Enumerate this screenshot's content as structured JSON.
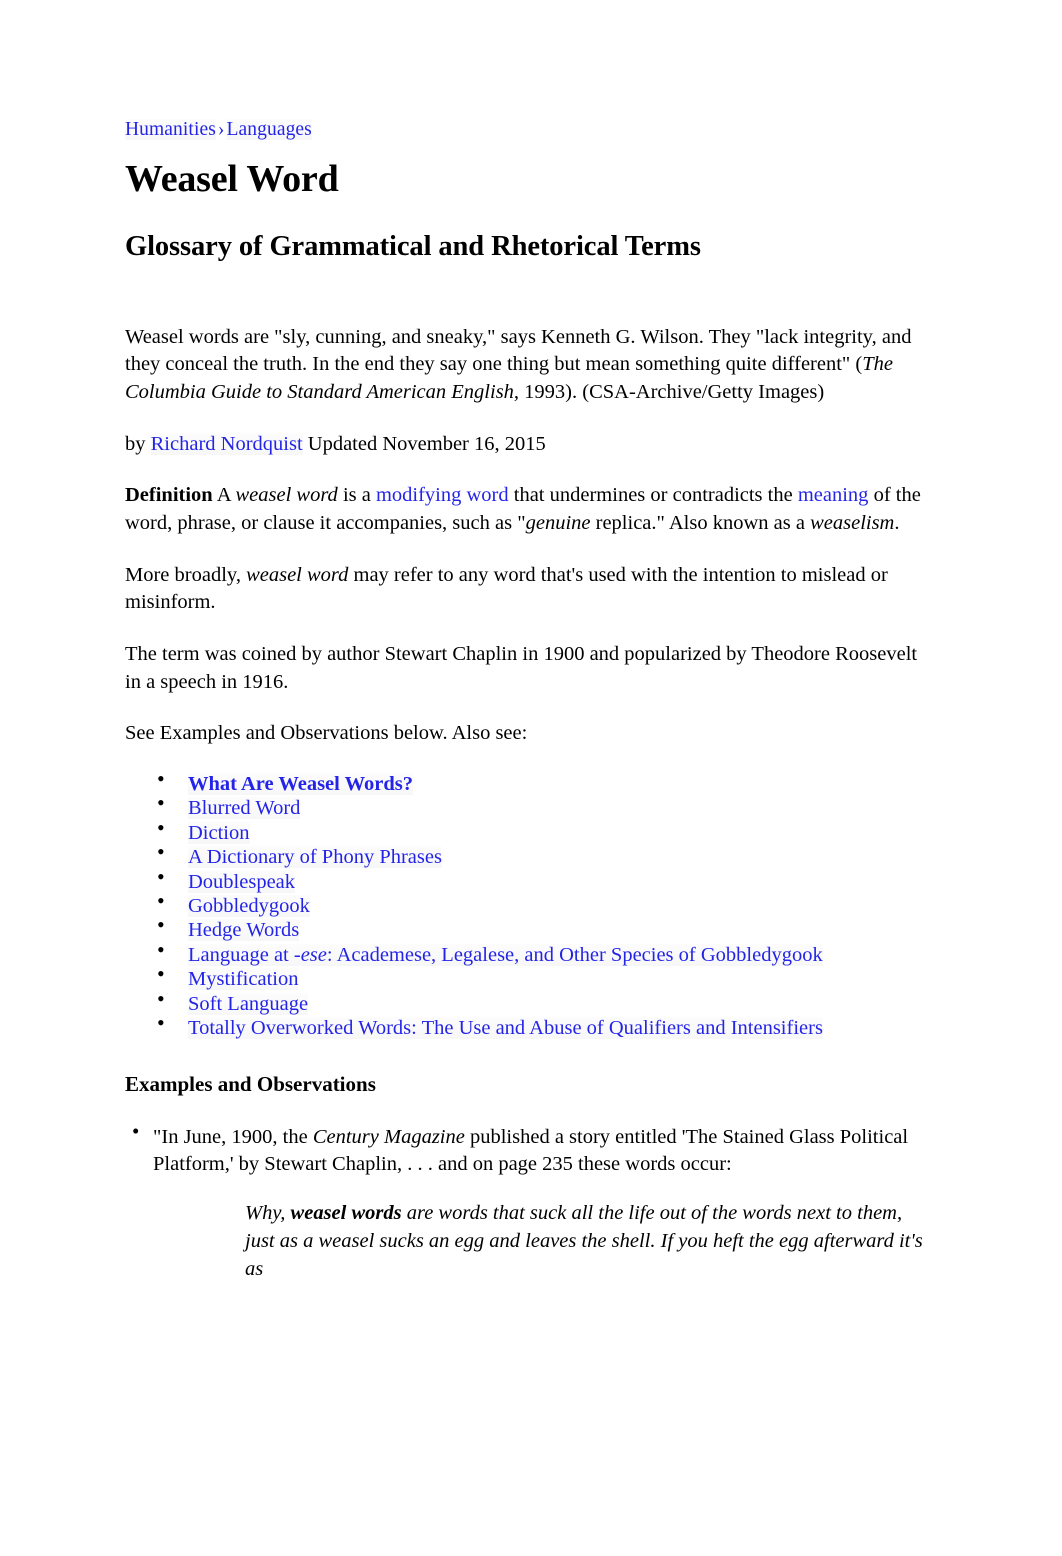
{
  "breadcrumb": {
    "items": [
      {
        "label": "Humanities"
      },
      {
        "label": "Languages"
      }
    ],
    "separator": "›"
  },
  "article": {
    "title": "Weasel Word",
    "subtitle": "Glossary of Grammatical and Rhetorical Terms",
    "lead": {
      "part1": "Weasel words are \"sly, cunning, and sneaky,\" says Kenneth G. Wilson. They \"lack integrity, and they conceal the truth. In the end they say one thing but mean something quite different\" (",
      "source_italic": "The Columbia Guide to Standard American English,",
      "part2": " 1993). (CSA-Archive/Getty Images)"
    },
    "byline": {
      "prefix": "by ",
      "author": "Richard Nordquist",
      "updated": " Updated November 16, 2015"
    },
    "definition": {
      "label": "Definition",
      "t1": " A ",
      "term1_italic": "weasel word",
      "t2": " is a ",
      "link1": "modifying word",
      "t3": " that undermines or contradicts the ",
      "link2": "meaning",
      "t4": " of the word, phrase, or clause it accompanies, such as \"",
      "term2_italic": "genuine",
      "t5": " replica.\" Also known as a ",
      "term3_italic": "weaselism",
      "t6": "."
    },
    "paragraph_broadly": {
      "t1": "More broadly, ",
      "term_italic": "weasel word",
      "t2": " may refer to any word that's used with the intention to mislead or misinform."
    },
    "paragraph_origin": "The term was coined by author Stewart Chaplin in 1900 and popularized by Theodore Roosevelt in a speech in 1916.",
    "paragraph_seealso": "See Examples and Observations below. Also see:"
  },
  "related_links": [
    {
      "label": "What Are Weasel Words?",
      "bold": true
    },
    {
      "label": "Blurred Word",
      "bold": false
    },
    {
      "label": "Diction",
      "bold": false
    },
    {
      "label": "A Dictionary of Phony Phrases",
      "bold": false
    },
    {
      "label": "Doublespeak",
      "bold": false
    },
    {
      "label": "Gobbledygook",
      "bold": false
    },
    {
      "label": "Hedge Words",
      "bold": false
    },
    {
      "label": "Language at -ese: Academese, Legalese, and Other Species of Gobbledygook",
      "bold": false,
      "italic_prefix": "Language at ",
      "italic_part": "-ese",
      "italic_suffix": ": Academese, Legalese, and Other Species of Gobbledygook"
    },
    {
      "label": "Mystification",
      "bold": false
    },
    {
      "label": "Soft Language",
      "bold": false
    },
    {
      "label": "Totally Overworked Words: The Use and Abuse of Qualifiers and Intensifiers",
      "bold": false
    }
  ],
  "examples": {
    "heading": "Examples and Observations",
    "item1": {
      "t1": "\"In June, 1900, the ",
      "italic": "Century Magazine",
      "t2": " published a story entitled 'The Stained Glass Political Platform,' by Stewart Chaplin, . . . and on page 235 these words occur:"
    },
    "quote": {
      "t1": "Why, ",
      "bold": "weasel words",
      "t2": " are words that suck all the life out of the words next to them, just as a weasel sucks an egg and leaves the shell. If you heft the egg afterward it's as"
    }
  },
  "colors": {
    "link": "#2424e8",
    "text": "#000000",
    "background": "#ffffff"
  }
}
